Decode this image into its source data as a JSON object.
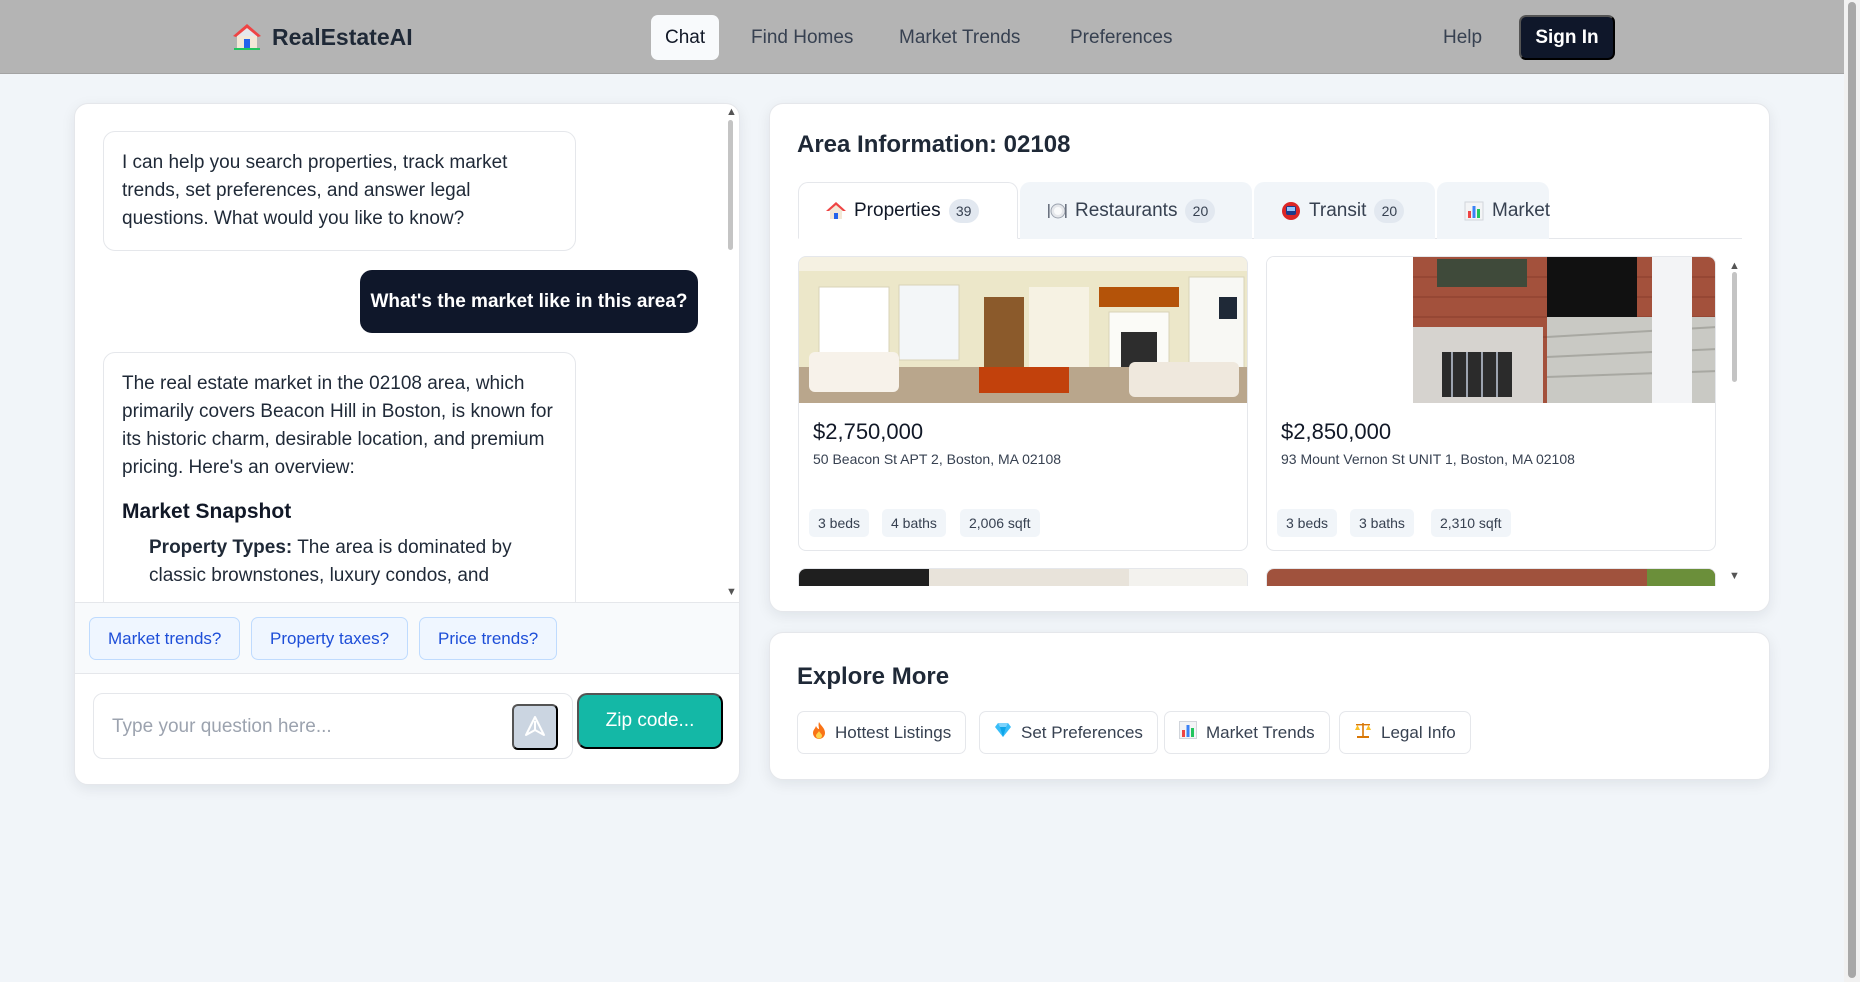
{
  "header": {
    "brand": "RealEstateAI",
    "nav": [
      "Chat",
      "Find Homes",
      "Market Trends",
      "Preferences"
    ],
    "active_nav": "Chat",
    "help": "Help",
    "sign_in": "Sign In"
  },
  "chat": {
    "messages": [
      {
        "role": "assistant",
        "text": "I can help you search properties, track market trends, set preferences, and answer legal questions. What would you like to know?"
      },
      {
        "role": "user",
        "text": "What's the market like in this area?"
      },
      {
        "role": "assistant",
        "text": "The real estate market in the 02108 area, which primarily covers Beacon Hill in Boston, is known for its historic charm, desirable location, and premium pricing. Here's an overview:",
        "heading": "Market Snapshot",
        "bullet_label": "Property Types:",
        "bullet_text": "The area is dominated by classic brownstones, luxury condos, and"
      }
    ],
    "suggestions": [
      "Market trends?",
      "Property taxes?",
      "Price trends?"
    ],
    "input_placeholder": "Type your question here...",
    "zip_button": "Zip code..."
  },
  "area": {
    "title": "Area Information: 02108",
    "tabs": [
      {
        "label": "Properties",
        "count": "39",
        "icon": "house-icon"
      },
      {
        "label": "Restaurants",
        "count": "20",
        "icon": "plate-icon"
      },
      {
        "label": "Transit",
        "count": "20",
        "icon": "metro-icon"
      },
      {
        "label": "Market",
        "icon": "bar-chart-icon"
      }
    ],
    "listings": [
      {
        "price": "$2,750,000",
        "address": "50 Beacon St APT 2, Boston, MA 02108",
        "beds": "3 beds",
        "baths": "4 baths",
        "sqft": "2,006 sqft"
      },
      {
        "price": "$2,850,000",
        "address": "93 Mount Vernon St UNIT 1, Boston, MA 02108",
        "beds": "3 beds",
        "baths": "3 baths",
        "sqft": "2,310 sqft"
      }
    ]
  },
  "explore": {
    "title": "Explore More",
    "buttons": [
      {
        "label": "Hottest Listings",
        "icon": "fire-icon"
      },
      {
        "label": "Set Preferences",
        "icon": "gem-icon"
      },
      {
        "label": "Market Trends",
        "icon": "bar-chart-icon"
      },
      {
        "label": "Legal Info",
        "icon": "scales-icon"
      }
    ]
  },
  "colors": {
    "header_bg": "#b4b4b4",
    "primary_dark": "#0f172a",
    "accent_teal": "#14b8a6",
    "chip_blue": "#1d4ed8"
  }
}
